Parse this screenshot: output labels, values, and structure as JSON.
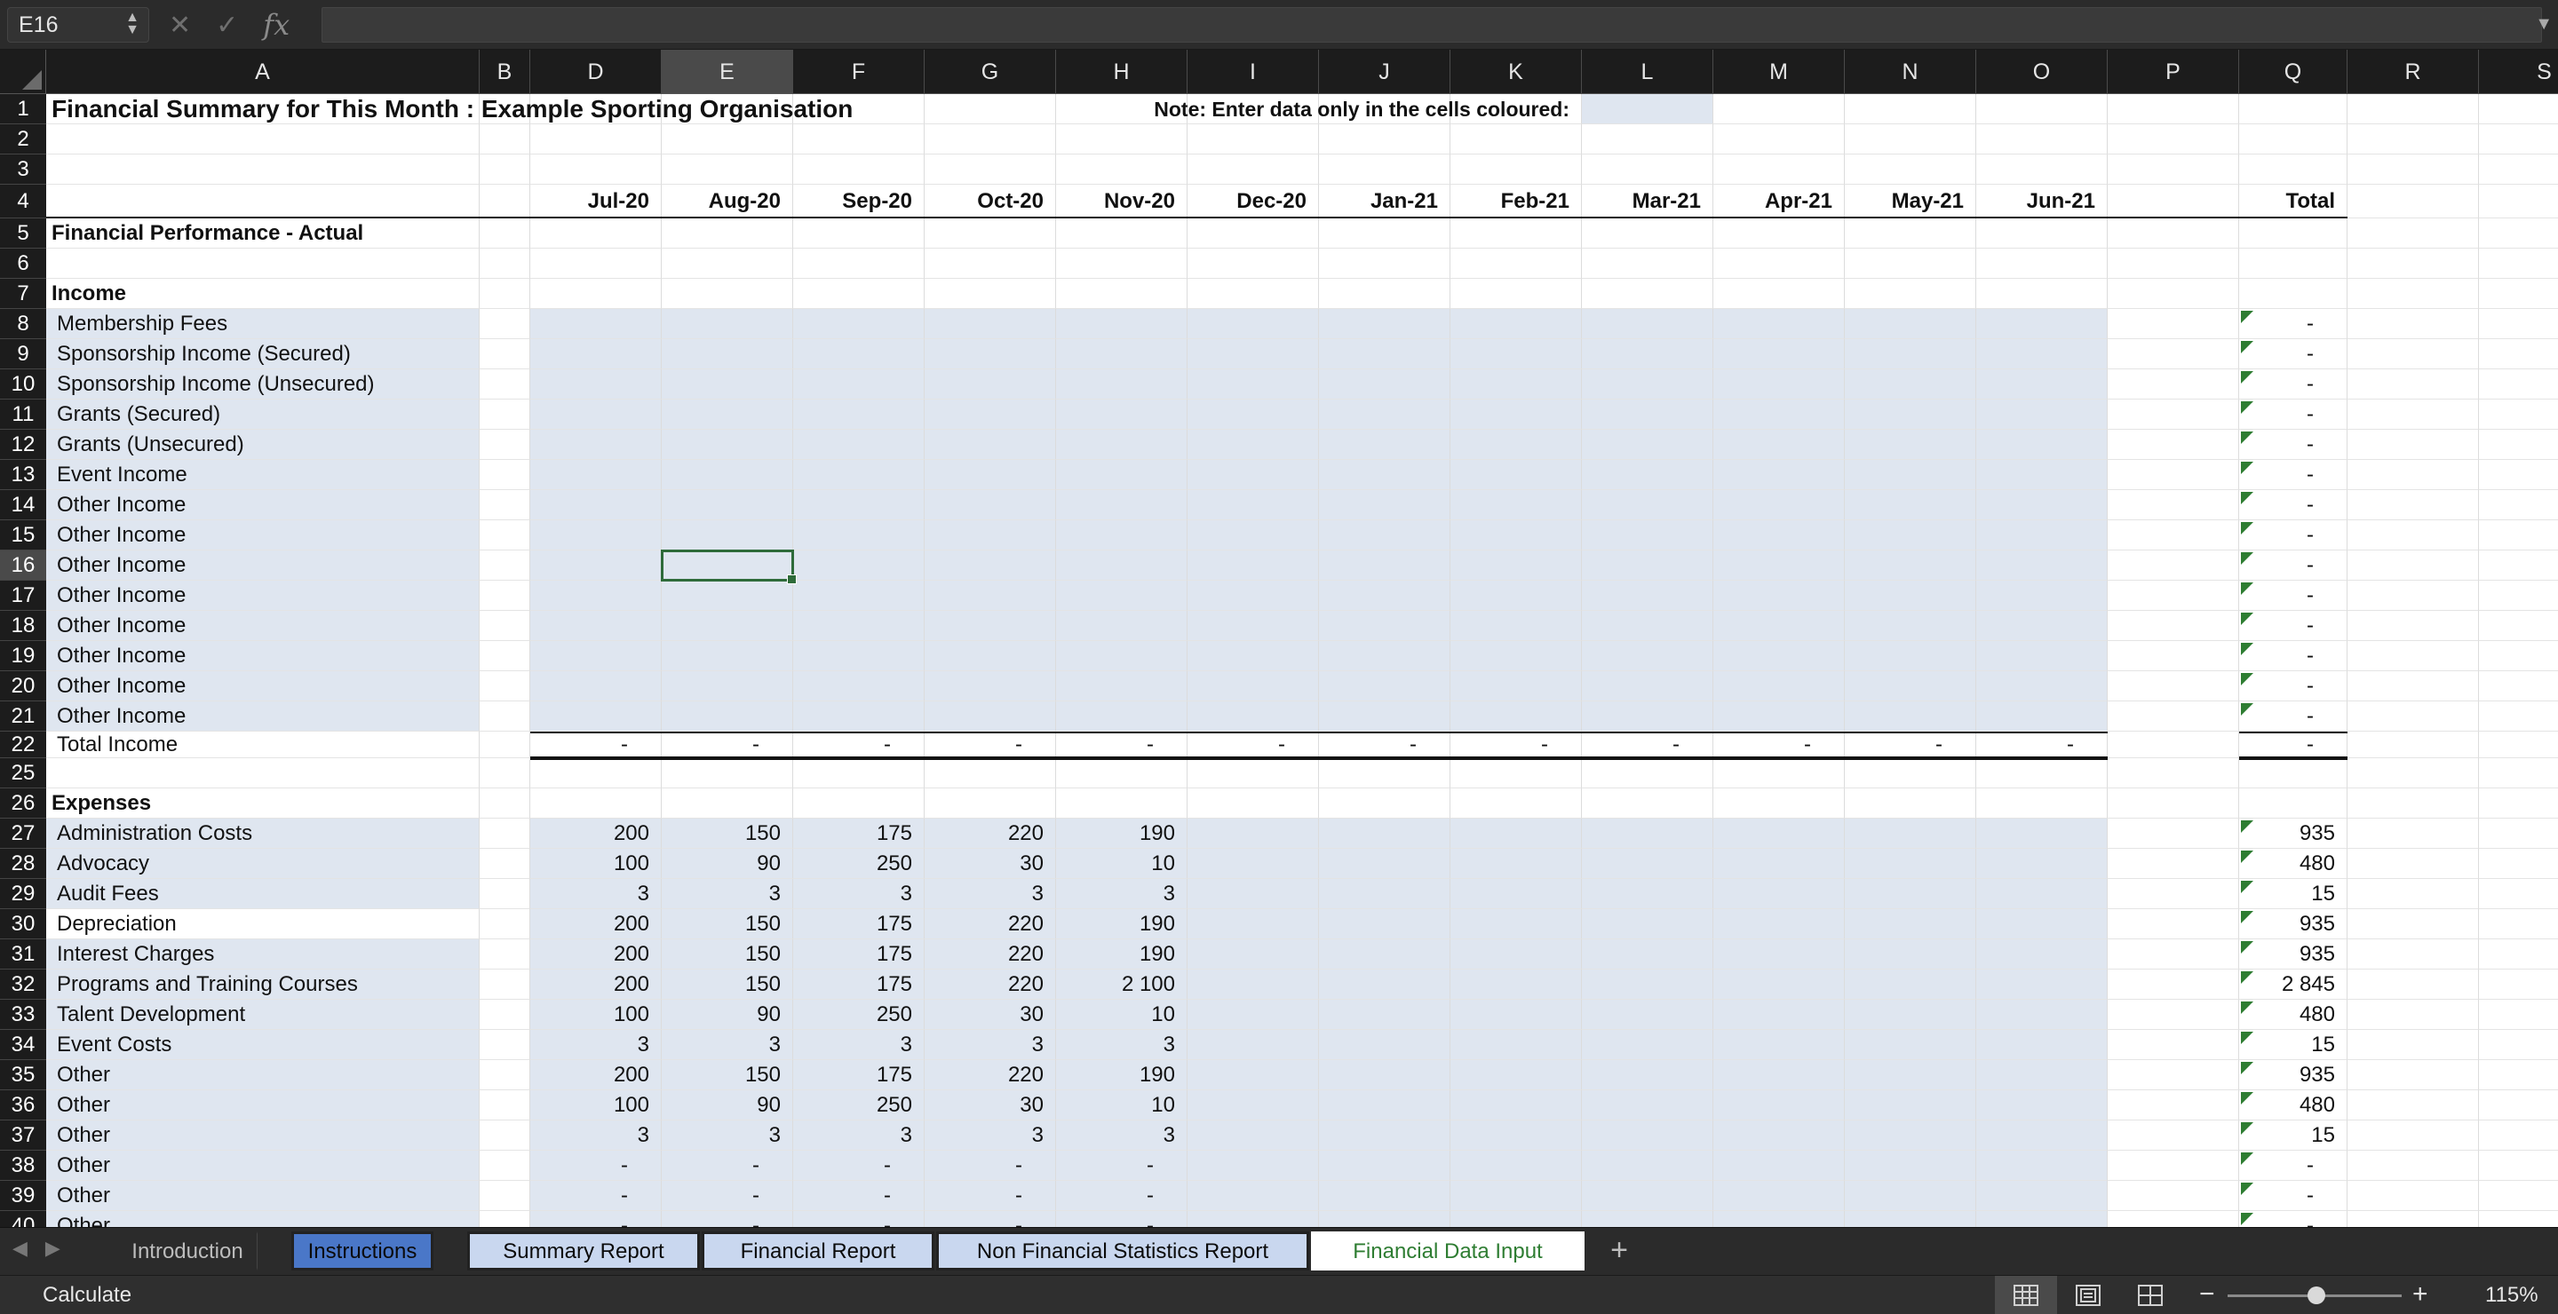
{
  "formula_bar": {
    "name_box": "E16",
    "fx_label": "fx",
    "formula": ""
  },
  "columns": [
    "A",
    "B",
    "D",
    "E",
    "F",
    "G",
    "H",
    "I",
    "J",
    "K",
    "L",
    "M",
    "N",
    "O",
    "P",
    "Q",
    "R",
    "S"
  ],
  "selected_cell": "E16",
  "title": "Financial Summary for This Month : Example Sporting Organisation",
  "note": "Note: Enter data only in the cells coloured:",
  "months": [
    "Jul-20",
    "Aug-20",
    "Sep-20",
    "Oct-20",
    "Nov-20",
    "Dec-20",
    "Jan-21",
    "Feb-21",
    "Mar-21",
    "Apr-21",
    "May-21",
    "Jun-21"
  ],
  "total_label": "Total",
  "section_actual": "Financial Performance - Actual",
  "income": {
    "heading": "Income",
    "items": [
      {
        "row": 8,
        "label": "Membership Fees",
        "total": "-"
      },
      {
        "row": 9,
        "label": "Sponsorship Income (Secured)",
        "total": "-"
      },
      {
        "row": 10,
        "label": "Sponsorship Income (Unsecured)",
        "total": "-"
      },
      {
        "row": 11,
        "label": "Grants (Secured)",
        "total": "-"
      },
      {
        "row": 12,
        "label": "Grants (Unsecured)",
        "total": "-"
      },
      {
        "row": 13,
        "label": "Event Income",
        "total": "-"
      },
      {
        "row": 14,
        "label": "Other Income",
        "total": "-"
      },
      {
        "row": 15,
        "label": "Other Income",
        "total": "-"
      },
      {
        "row": 16,
        "label": "Other Income",
        "total": "-"
      },
      {
        "row": 17,
        "label": "Other Income",
        "total": "-"
      },
      {
        "row": 18,
        "label": "Other Income",
        "total": "-"
      },
      {
        "row": 19,
        "label": "Other Income",
        "total": "-"
      },
      {
        "row": 20,
        "label": "Other Income",
        "total": "-"
      },
      {
        "row": 21,
        "label": "Other Income",
        "total": "-"
      }
    ],
    "total_row": {
      "row": 22,
      "label": "Total Income",
      "values": [
        "-",
        "-",
        "-",
        "-",
        "-",
        "-",
        "-",
        "-",
        "-",
        "-",
        "-",
        "-"
      ],
      "total": "-"
    }
  },
  "expenses": {
    "heading": "Expenses",
    "items": [
      {
        "row": 27,
        "label": "Administration Costs",
        "values": [
          "200",
          "150",
          "175",
          "220",
          "190"
        ],
        "total": "935"
      },
      {
        "row": 28,
        "label": "Advocacy",
        "values": [
          "100",
          "90",
          "250",
          "30",
          "10"
        ],
        "total": "480"
      },
      {
        "row": 29,
        "label": "Audit Fees",
        "values": [
          "3",
          "3",
          "3",
          "3",
          "3"
        ],
        "total": "15"
      },
      {
        "row": 30,
        "label": "Depreciation",
        "values": [
          "200",
          "150",
          "175",
          "220",
          "190"
        ],
        "total": "935"
      },
      {
        "row": 31,
        "label": "Interest Charges",
        "values": [
          "200",
          "150",
          "175",
          "220",
          "190"
        ],
        "total": "935"
      },
      {
        "row": 32,
        "label": "Programs and Training Courses",
        "values": [
          "200",
          "150",
          "175",
          "220",
          "2 100"
        ],
        "total": "2 845"
      },
      {
        "row": 33,
        "label": "Talent Development",
        "values": [
          "100",
          "90",
          "250",
          "30",
          "10"
        ],
        "total": "480"
      },
      {
        "row": 34,
        "label": "Event Costs",
        "values": [
          "3",
          "3",
          "3",
          "3",
          "3"
        ],
        "total": "15"
      },
      {
        "row": 35,
        "label": "Other",
        "values": [
          "200",
          "150",
          "175",
          "220",
          "190"
        ],
        "total": "935"
      },
      {
        "row": 36,
        "label": "Other",
        "values": [
          "100",
          "90",
          "250",
          "30",
          "10"
        ],
        "total": "480"
      },
      {
        "row": 37,
        "label": "Other",
        "values": [
          "3",
          "3",
          "3",
          "3",
          "3"
        ],
        "total": "15"
      },
      {
        "row": 38,
        "label": "Other",
        "values": [
          "-",
          "-",
          "-",
          "-",
          "-"
        ],
        "total": "-"
      },
      {
        "row": 39,
        "label": "Other",
        "values": [
          "-",
          "-",
          "-",
          "-",
          "-"
        ],
        "total": "-"
      },
      {
        "row": 40,
        "label": "Other",
        "values": [
          "-",
          "-",
          "-",
          "-",
          "-"
        ],
        "total": "-"
      }
    ]
  },
  "row_numbers": [
    "1",
    "2",
    "3",
    "4",
    "5",
    "6",
    "7",
    "8",
    "9",
    "10",
    "11",
    "12",
    "13",
    "14",
    "15",
    "16",
    "17",
    "18",
    "19",
    "20",
    "21",
    "22",
    "25",
    "26",
    "27",
    "28",
    "29",
    "30",
    "31",
    "32",
    "33",
    "34",
    "35",
    "36",
    "37",
    "38",
    "39",
    "40"
  ],
  "sheet_tabs": [
    {
      "label": "Introduction",
      "style": "plain"
    },
    {
      "label": "Instructions",
      "style": "blue-strong"
    },
    {
      "label": "Summary Report",
      "style": "blue-soft"
    },
    {
      "label": "Financial Report",
      "style": "blue-soft"
    },
    {
      "label": "Non Financial Statistics Report",
      "style": "blue-soft"
    },
    {
      "label": "Financial Data Input",
      "style": "active"
    }
  ],
  "status": {
    "text": "Calculate",
    "zoom": "115%",
    "view_buttons": [
      "normal-view-icon",
      "page-layout-icon",
      "page-break-icon"
    ]
  },
  "colors": {
    "input_fill": "#dfe6f0",
    "active_tab": "#2e7d32",
    "selection": "#2e6b3a"
  }
}
